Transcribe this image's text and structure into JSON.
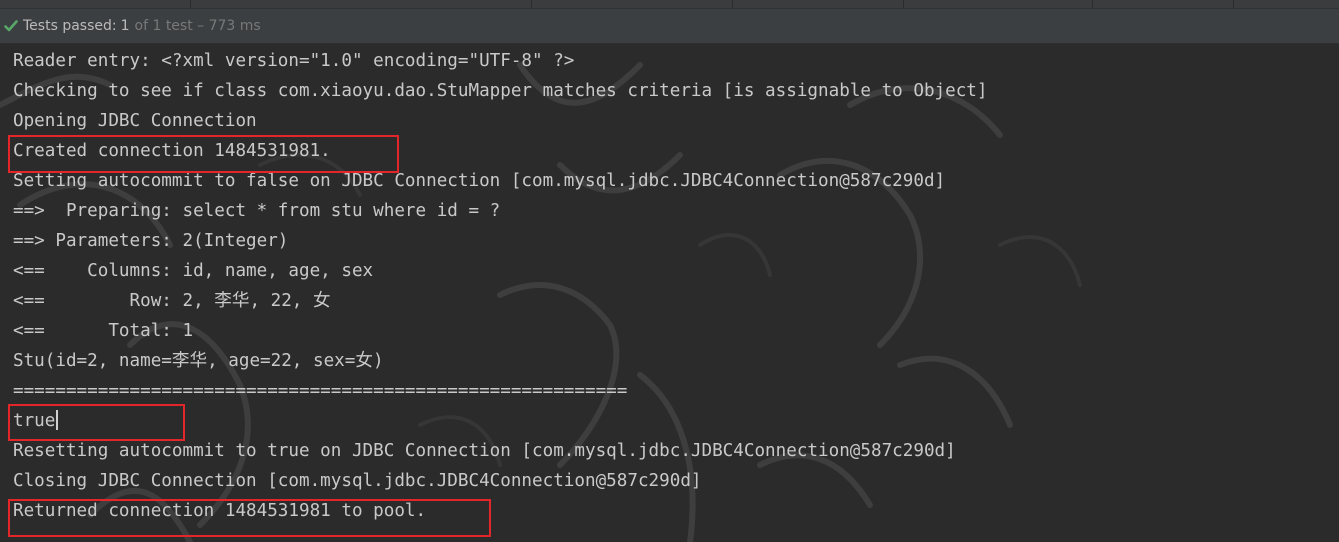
{
  "status_bar": {
    "icon": "check-icon",
    "label": "Tests passed:",
    "passed_count": "1",
    "detail": "of 1 test – 773 ms",
    "colors": {
      "check": "#59a869",
      "text": "#bbbbbb",
      "dim": "#787878"
    }
  },
  "console": {
    "lines": [
      "Reader entry: <?xml version=\"1.0\" encoding=\"UTF-8\" ?>",
      "Checking to see if class com.xiaoyu.dao.StuMapper matches criteria [is assignable to Object]",
      "Opening JDBC Connection",
      "Created connection 1484531981.",
      "Setting autocommit to false on JDBC Connection [com.mysql.jdbc.JDBC4Connection@587c290d]",
      "==>  Preparing: select * from stu where id = ?",
      "==> Parameters: 2(Integer)",
      "<==    Columns: id, name, age, sex",
      "<==        Row: 2, 李华, 22, 女",
      "<==      Total: 1",
      "Stu(id=2, name=李华, age=22, sex=女)",
      "==========================================================",
      "true",
      "Resetting autocommit to true on JDBC Connection [com.mysql.jdbc.JDBC4Connection@587c290d]",
      "Closing JDBC Connection [com.mysql.jdbc.JDBC4Connection@587c290d]",
      "Returned connection 1484531981 to pool."
    ],
    "highlight_color": "#e2262a",
    "background": "#2b2b2b",
    "text_color": "#c9c9c9"
  }
}
